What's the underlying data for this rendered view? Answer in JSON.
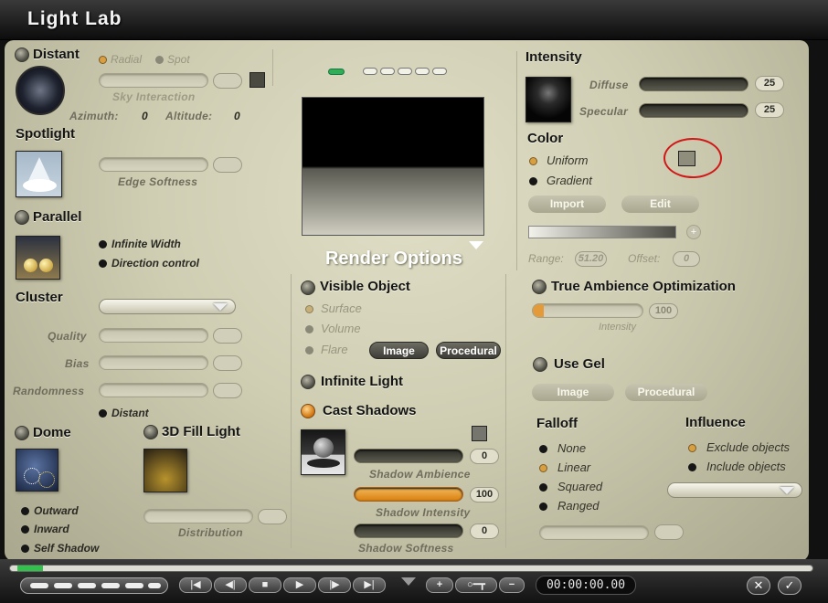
{
  "window": {
    "title": "Light Lab"
  },
  "left": {
    "distant": {
      "label": "Distant",
      "radial": "Radial",
      "spot": "Spot",
      "sky_interaction": "Sky Interaction",
      "azimuth_label": "Azimuth:",
      "azimuth_value": "0",
      "altitude_label": "Altitude:",
      "altitude_value": "0"
    },
    "spotlight": {
      "label": "Spotlight",
      "edge_softness": "Edge Softness"
    },
    "parallel": {
      "label": "Parallel",
      "infinite_width": "Infinite Width",
      "direction_control": "Direction control"
    },
    "cluster": {
      "label": "Cluster",
      "quality": "Quality",
      "bias": "Bias",
      "randomness": "Randomness",
      "distant": "Distant"
    },
    "dome": {
      "label": "Dome",
      "outward": "Outward",
      "inward": "Inward",
      "self_shadow": "Self Shadow"
    },
    "fill": {
      "label": "3D Fill Light",
      "distribution": "Distribution"
    }
  },
  "center": {
    "render_options": "Render Options",
    "visible_object": "Visible Object",
    "surface": "Surface",
    "volume": "Volume",
    "flare": "Flare",
    "image_btn": "Image",
    "procedural_btn": "Procedural",
    "infinite_light": "Infinite Light",
    "cast_shadows": "Cast Shadows",
    "shadow_ambience": {
      "label": "Shadow Ambience",
      "value": "0"
    },
    "shadow_intensity": {
      "label": "Shadow Intensity",
      "value": "100"
    },
    "shadow_softness": {
      "label": "Shadow Softness",
      "value": "0"
    }
  },
  "right": {
    "intensity": "Intensity",
    "diffuse": {
      "label": "Diffuse",
      "value": "25"
    },
    "specular": {
      "label": "Specular",
      "value": "25"
    },
    "color": "Color",
    "uniform": "Uniform",
    "gradient": "Gradient",
    "import_btn": "Import",
    "edit_btn": "Edit",
    "range_label": "Range:",
    "range_value": "51.20",
    "offset_label": "Offset:",
    "offset_value": "0",
    "true_ambience": "True Ambience Optimization",
    "ta_intensity": "Intensity",
    "ta_value": "100",
    "use_gel": "Use Gel",
    "gel_image": "Image",
    "gel_procedural": "Procedural",
    "falloff": {
      "label": "Falloff",
      "options": [
        "None",
        "Linear",
        "Squared",
        "Ranged"
      ]
    },
    "influence": {
      "label": "Influence",
      "options": [
        "Exclude objects",
        "Include objects"
      ]
    }
  },
  "bottom": {
    "timecode": "00:00:00.00",
    "add": "+",
    "minus": "−",
    "cancel": "✕",
    "ok": "✓"
  },
  "colors": {
    "accent_orange": "#d9800f",
    "highlight_ring": "#d01818"
  }
}
